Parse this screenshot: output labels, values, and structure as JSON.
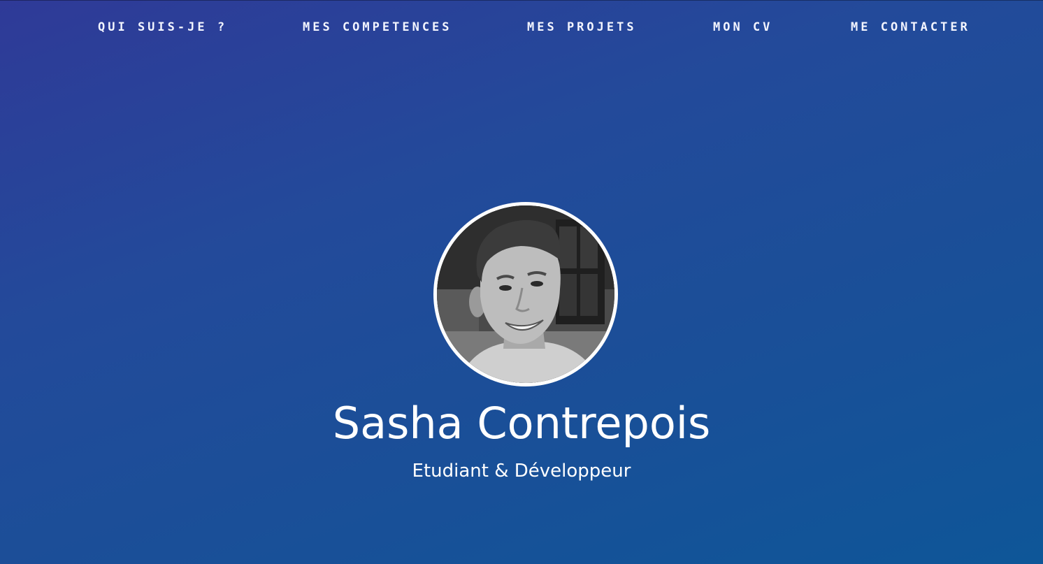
{
  "nav": {
    "items": [
      {
        "label": "QUI SUIS-JE ?"
      },
      {
        "label": "MES COMPETENCES"
      },
      {
        "label": "MES PROJETS"
      },
      {
        "label": "MON CV"
      },
      {
        "label": "ME CONTACTER"
      }
    ]
  },
  "hero": {
    "name": "Sasha Contrepois",
    "subtitle": "Etudiant & Développeur",
    "avatar_icon": "profile-photo"
  },
  "colors": {
    "gradient_start": "#2f3a98",
    "gradient_end": "#0e5698",
    "text": "#ffffff"
  }
}
